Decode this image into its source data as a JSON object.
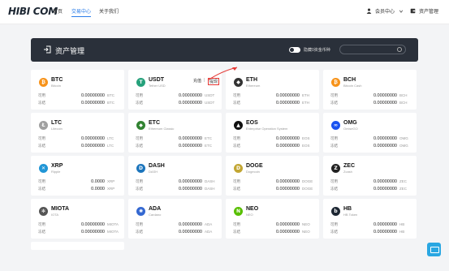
{
  "brand": {
    "name": "HIBI COM",
    "tagline": ""
  },
  "nav": [
    "首页",
    "交易中心",
    "关于我们"
  ],
  "user": {
    "account": "会员中心",
    "assets": "资产管理"
  },
  "header": {
    "title": "资产管理",
    "toggle_label": "隐藏0资金币种",
    "search_placeholder": ""
  },
  "labels": {
    "available": "可用",
    "frozen": "冻结"
  },
  "actions": {
    "deposit": "充值",
    "withdraw": "提现"
  },
  "colors": {
    "accent": "#2b7de9",
    "header_bg": "#2a303a",
    "highlight": "#e53935"
  },
  "coins": [
    {
      "symbol": "BTC",
      "name": "Bitcoin",
      "available": "0.00000000",
      "frozen": "0.00000000",
      "unit": "BTC",
      "icon": "btc-icon",
      "color": "#f7931a",
      "glyph": "₿"
    },
    {
      "symbol": "USDT",
      "name": "Tether USD",
      "available": "0.00000000",
      "frozen": "0.00000000",
      "unit": "USDT",
      "icon": "usdt-icon",
      "color": "#26a17b",
      "glyph": "T"
    },
    {
      "symbol": "ETH",
      "name": "Ethereum",
      "available": "0.00000000",
      "frozen": "0.00000000",
      "unit": "ETH",
      "icon": "eth-icon",
      "color": "#333333",
      "glyph": "◆"
    },
    {
      "symbol": "BCH",
      "name": "Bitcoin Cash",
      "available": "0.00000000",
      "frozen": "0.00000000",
      "unit": "BCH",
      "icon": "bch-icon",
      "color": "#f7931a",
      "glyph": "₿"
    },
    {
      "symbol": "LTC",
      "name": "Litecoin",
      "available": "0.00000000",
      "frozen": "0.00000000",
      "unit": "LTC",
      "icon": "ltc-icon",
      "color": "#a0a0a0",
      "glyph": "Ł"
    },
    {
      "symbol": "ETC",
      "name": "Ethereum Classic",
      "available": "0.00000000",
      "frozen": "0.00000000",
      "unit": "ETC",
      "icon": "etc-icon",
      "color": "#328332",
      "glyph": "◆"
    },
    {
      "symbol": "EOS",
      "name": "Enterprise Operation System",
      "available": "0.00000000",
      "frozen": "0.00000000",
      "unit": "EOS",
      "icon": "eos-icon",
      "color": "#111111",
      "glyph": "▲"
    },
    {
      "symbol": "OMG",
      "name": "OmiseGO",
      "available": "0.00000000",
      "frozen": "0.00000000",
      "unit": "OMG",
      "icon": "omg-icon",
      "color": "#1a53f0",
      "glyph": "∞"
    },
    {
      "symbol": "XRP",
      "name": "Ripple",
      "available": "0.0000",
      "frozen": "0.0000",
      "unit": "XRP",
      "icon": "xrp-icon",
      "color": "#2196d6",
      "glyph": "✕"
    },
    {
      "symbol": "DASH",
      "name": "DASH",
      "available": "0.00000000",
      "frozen": "0.00000000",
      "unit": "DASH",
      "icon": "dash-icon",
      "color": "#1c75bc",
      "glyph": "D"
    },
    {
      "symbol": "DOGE",
      "name": "Dogecoin",
      "available": "0.00000000",
      "frozen": "0.00000000",
      "unit": "DOGE",
      "icon": "doge-icon",
      "color": "#c2a633",
      "glyph": "D"
    },
    {
      "symbol": "ZEC",
      "name": "Zcash",
      "available": "0.00000000",
      "frozen": "0.00000000",
      "unit": "ZEC",
      "icon": "zec-icon",
      "color": "#222222",
      "glyph": "Z"
    },
    {
      "symbol": "MIOTA",
      "name": "IOTA",
      "available": "0.00000000",
      "frozen": "0.00000000",
      "unit": "MIOTA",
      "icon": "iota-icon",
      "color": "#555555",
      "glyph": "✻"
    },
    {
      "symbol": "ADA",
      "name": "Cardano",
      "available": "0.00000000",
      "frozen": "0.00000000",
      "unit": "ADA",
      "icon": "ada-icon",
      "color": "#3468d1",
      "glyph": "✺"
    },
    {
      "symbol": "NEO",
      "name": "NEO",
      "available": "0.00000000",
      "frozen": "0.00000000",
      "unit": "NEO",
      "icon": "neo-icon",
      "color": "#58bf00",
      "glyph": "N"
    },
    {
      "symbol": "HB",
      "name": "HB Token",
      "available": "0.00000000",
      "frozen": "0.00000000",
      "unit": "HB",
      "icon": "hb-icon",
      "color": "#1d2733",
      "glyph": "b"
    }
  ]
}
